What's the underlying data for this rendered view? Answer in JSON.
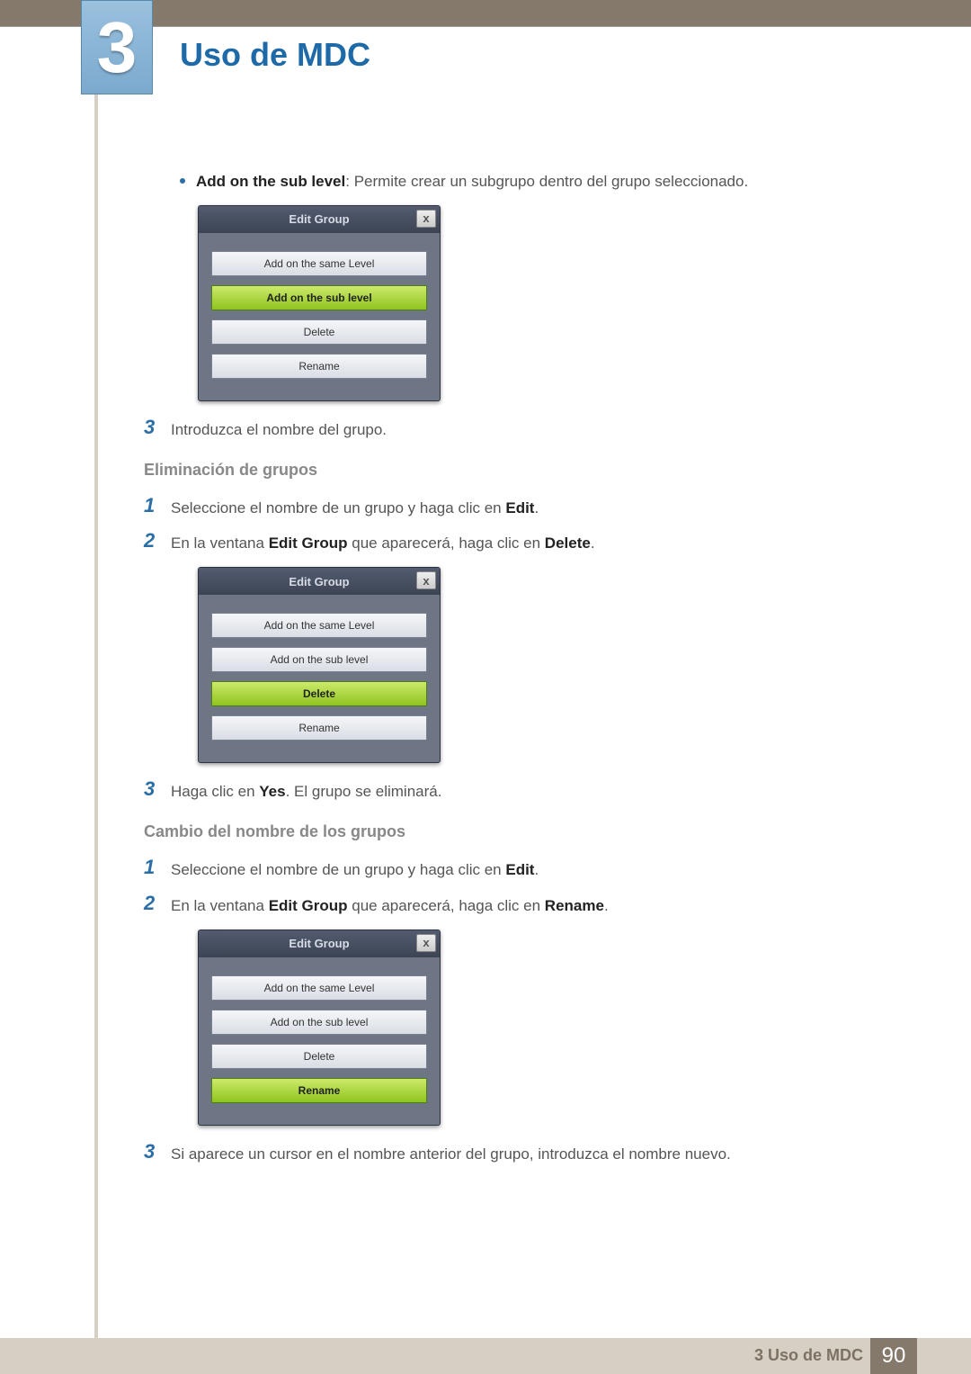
{
  "chapter": {
    "number": "3",
    "title": "Uso de MDC"
  },
  "intro": {
    "bold": "Add on the sub level",
    "rest": ": Permite crear un subgrupo dentro del grupo seleccionado."
  },
  "dialog": {
    "title": "Edit Group",
    "close": "x",
    "btn_same": "Add on the same Level",
    "btn_sub": "Add on the sub level",
    "btn_delete": "Delete",
    "btn_rename": "Rename"
  },
  "step_intro3": "Introduzca el nombre del grupo.",
  "section_delete": {
    "heading": "Eliminación de grupos",
    "s1_a": "Seleccione el nombre de un grupo y haga clic en ",
    "s1_b": "Edit",
    "s1_c": ".",
    "s2_a": "En la ventana ",
    "s2_b": "Edit Group",
    "s2_c": " que aparecerá, haga clic en ",
    "s2_d": "Delete",
    "s2_e": ".",
    "s3_a": "Haga clic en ",
    "s3_b": "Yes",
    "s3_c": ". El grupo se eliminará."
  },
  "section_rename": {
    "heading": "Cambio del nombre de los grupos",
    "s1_a": "Seleccione el nombre de un grupo y haga clic en ",
    "s1_b": "Edit",
    "s1_c": ".",
    "s2_a": "En la ventana ",
    "s2_b": "Edit Group",
    "s2_c": " que aparecerá, haga clic en ",
    "s2_d": "Rename",
    "s2_e": ".",
    "s3": "Si aparece un cursor en el nombre anterior del grupo, introduzca el nombre nuevo."
  },
  "footer": {
    "chapter_ref": "3 Uso de MDC",
    "page": "90"
  }
}
